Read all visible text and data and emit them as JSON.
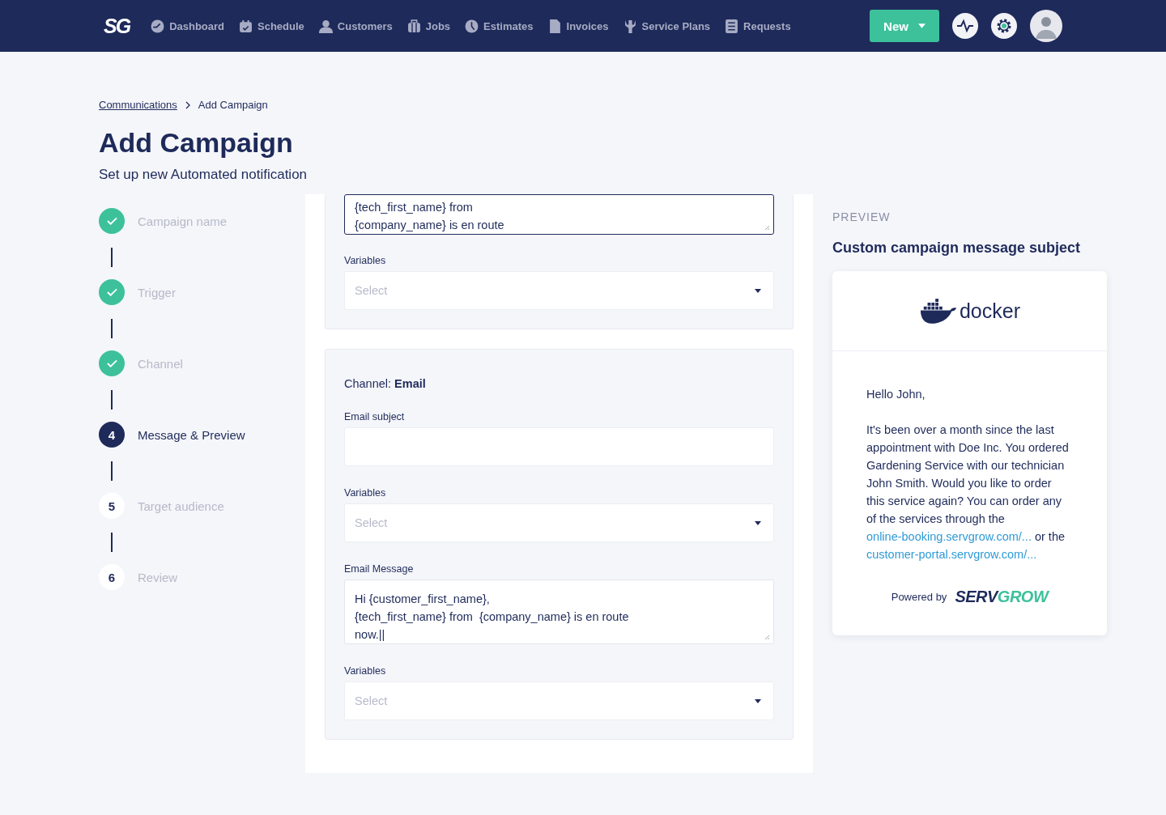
{
  "nav": {
    "logo": "SG",
    "items": [
      {
        "label": "Dashboard"
      },
      {
        "label": "Schedule"
      },
      {
        "label": "Customers"
      },
      {
        "label": "Jobs"
      },
      {
        "label": "Estimates"
      },
      {
        "label": "Invoices"
      },
      {
        "label": "Service Plans"
      },
      {
        "label": "Requests"
      }
    ],
    "new_button": "New"
  },
  "breadcrumb": [
    "Communications",
    "Add Campaign"
  ],
  "title": "Add Campaign",
  "subtitle": "Set up new Automated notification",
  "steps": [
    {
      "label": "Campaign name",
      "completed": true,
      "selected": false
    },
    {
      "label": "Trigger",
      "completed": true,
      "selected": false
    },
    {
      "label": "Channel",
      "completed": true,
      "selected": false
    },
    {
      "marker": "4",
      "label": "Message & Preview",
      "completed": false,
      "selected": true
    },
    {
      "marker": "5",
      "label": "Target audience",
      "completed": false,
      "selected": false
    },
    {
      "marker": "6",
      "label": "Review",
      "completed": false,
      "selected": false
    }
  ],
  "sms_panel": {
    "message": "{tech_first_name} from\n{company_name} is en route",
    "variables_label": "Variables",
    "variables_placeholder": "Select"
  },
  "email_panel": {
    "channel_label": "Channel:",
    "channel_value": "Email",
    "subject_label": "Email subject",
    "variables_label": "Variables",
    "variables_placeholder": "Select",
    "message_label": "Email Message",
    "message": "Hi {customer_first_name},\n{tech_first_name} from  {company_name} is en route\nnow.||",
    "variables2_label": "Variables",
    "variables2_placeholder": "Select"
  },
  "preview": {
    "heading": "PREVIEW",
    "subject": "Custom campaign message subject",
    "brand": "docker",
    "greeting": "Hello John,",
    "body": [
      {
        "kind": "text",
        "text": "It's been over a month since the last appointment with Doe Inc. You ordered Gardening Service with our technician John Smith. Would you like to order this service again? You can order any of the services through the "
      },
      {
        "kind": "link",
        "text": "online-booking.servgrow.com/..."
      },
      {
        "kind": "text",
        "text": " or the "
      },
      {
        "kind": "link",
        "text": "customer-portal.servgrow.com/..."
      }
    ],
    "powered_by": "Powered by",
    "powered_brand_a": "SERV",
    "powered_brand_b": "GROW"
  }
}
